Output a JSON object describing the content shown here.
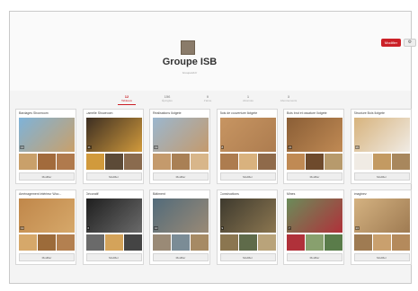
{
  "header": {
    "title": "Groupe ISB",
    "subtitle": "Groupeisb.fr",
    "follow_label": "Modifier",
    "settings_icon": "gear-icon"
  },
  "stats": [
    {
      "num": "12",
      "label": "Tableaux",
      "active": true
    },
    {
      "num": "156",
      "label": "Épingles",
      "active": false
    },
    {
      "num": "0",
      "label": "J'aime",
      "active": false
    },
    {
      "num": "1",
      "label": "Abonnés",
      "active": false
    },
    {
      "num": "3",
      "label": "Abonnements",
      "active": false
    }
  ],
  "boards": [
    {
      "title": "Bardages Showroom",
      "count": "14",
      "edit": "Modifier",
      "colors": [
        "#7eb3d9",
        "#c9a06a",
        "#a26b3c",
        "#b07a4d"
      ]
    },
    {
      "title": "Lamelle Showroom",
      "count": "11",
      "edit": "Modifier",
      "colors": [
        "#3c2e22",
        "#d19a3c",
        "#5c4a37",
        "#8a6b4e"
      ]
    },
    {
      "title": "Réalisations Ilotgete",
      "count": "19",
      "edit": "Modifier",
      "colors": [
        "#9bb7cf",
        "#c49a6c",
        "#a98055",
        "#d8b68a"
      ]
    },
    {
      "title": "Bois de couverture Ilotgete",
      "count": "8",
      "edit": "Modifier",
      "colors": [
        "#c79562",
        "#ad7c4f",
        "#d9b27e",
        "#8f6a4a"
      ]
    },
    {
      "title": "Bois brut et ossature Ilotgete",
      "count": "21",
      "edit": "Modifier",
      "colors": [
        "#8a5e36",
        "#c08a54",
        "#6e4a2c",
        "#b79a6c"
      ]
    },
    {
      "title": "Structure Bois Ilotgete",
      "count": "16",
      "edit": "Modifier",
      "colors": [
        "#d7b37d",
        "#f0ebe4",
        "#c39a62",
        "#a8875d"
      ]
    },
    {
      "title": "Aménagement intérieur Woo...",
      "count": "13",
      "edit": "Modifier",
      "colors": [
        "#c0874a",
        "#d6a86a",
        "#9c6b3a",
        "#b38050"
      ]
    },
    {
      "title": "Décoratif",
      "count": "6",
      "edit": "Modifier",
      "colors": [
        "#1f1f1f",
        "#6a6a6a",
        "#d4a35a",
        "#444444"
      ]
    },
    {
      "title": "Bâtiment",
      "count": "10",
      "edit": "Modifier",
      "colors": [
        "#526b7a",
        "#9a8a76",
        "#7b8c96",
        "#a68a64"
      ]
    },
    {
      "title": "Constructions",
      "count": "9",
      "edit": "Modifier",
      "colors": [
        "#3e3a2e",
        "#8b7650",
        "#5f6b4a",
        "#b9a37a"
      ]
    },
    {
      "title": "Mines",
      "count": "7",
      "edit": "Modifier",
      "colors": [
        "#6a8c5a",
        "#b0313a",
        "#88a06e",
        "#5a7c4a"
      ]
    },
    {
      "title": "Imaginez",
      "count": "14",
      "edit": "Modifier",
      "colors": [
        "#d4b281",
        "#9f7b52",
        "#c9a06e",
        "#b48a5c"
      ]
    }
  ]
}
